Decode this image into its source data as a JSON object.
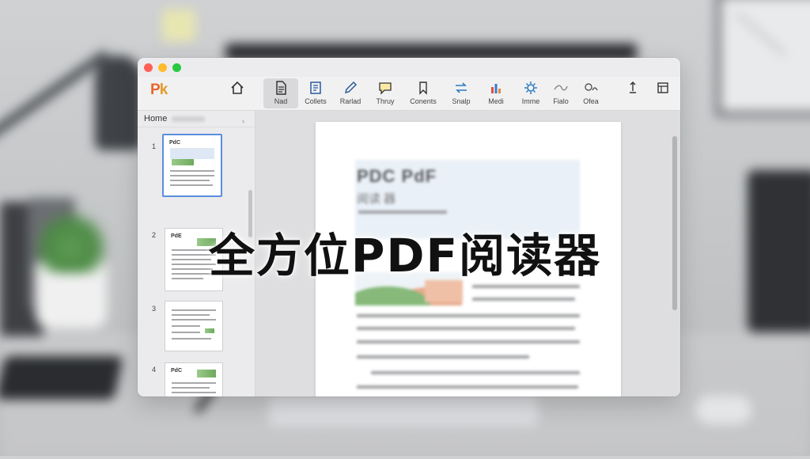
{
  "app": {
    "logo_p": "P",
    "logo_k": "k",
    "accent": "#e8672a"
  },
  "toolbar": {
    "items": [
      {
        "label": "",
        "icon": "home-icon"
      },
      {
        "label": "Nad",
        "icon": "document-icon",
        "active": true
      },
      {
        "label": "Collets",
        "icon": "notes-icon"
      },
      {
        "label": "Rarlad",
        "icon": "pen-icon"
      },
      {
        "label": "Thruy",
        "icon": "comment-icon"
      },
      {
        "label": "Conents",
        "icon": "bookmark-icon"
      },
      {
        "label": "Snalp",
        "icon": "sync-icon"
      },
      {
        "label": "Medi",
        "icon": "chart-icon"
      },
      {
        "label": "Imme",
        "icon": "gear-icon"
      },
      {
        "label": "Fialo",
        "icon": "wave-icon"
      },
      {
        "label": "Ofea",
        "icon": "shapes-icon"
      },
      {
        "label": "",
        "icon": "share-icon"
      },
      {
        "label": "",
        "icon": "panel-icon"
      }
    ]
  },
  "sidebar": {
    "header": "Home",
    "pages": [
      "1",
      "2",
      "3",
      "4"
    ]
  },
  "document": {
    "title": "PDC PdF",
    "subtitle": "阅读 器"
  },
  "overlay": {
    "caption": "全方位PDF阅读器"
  }
}
